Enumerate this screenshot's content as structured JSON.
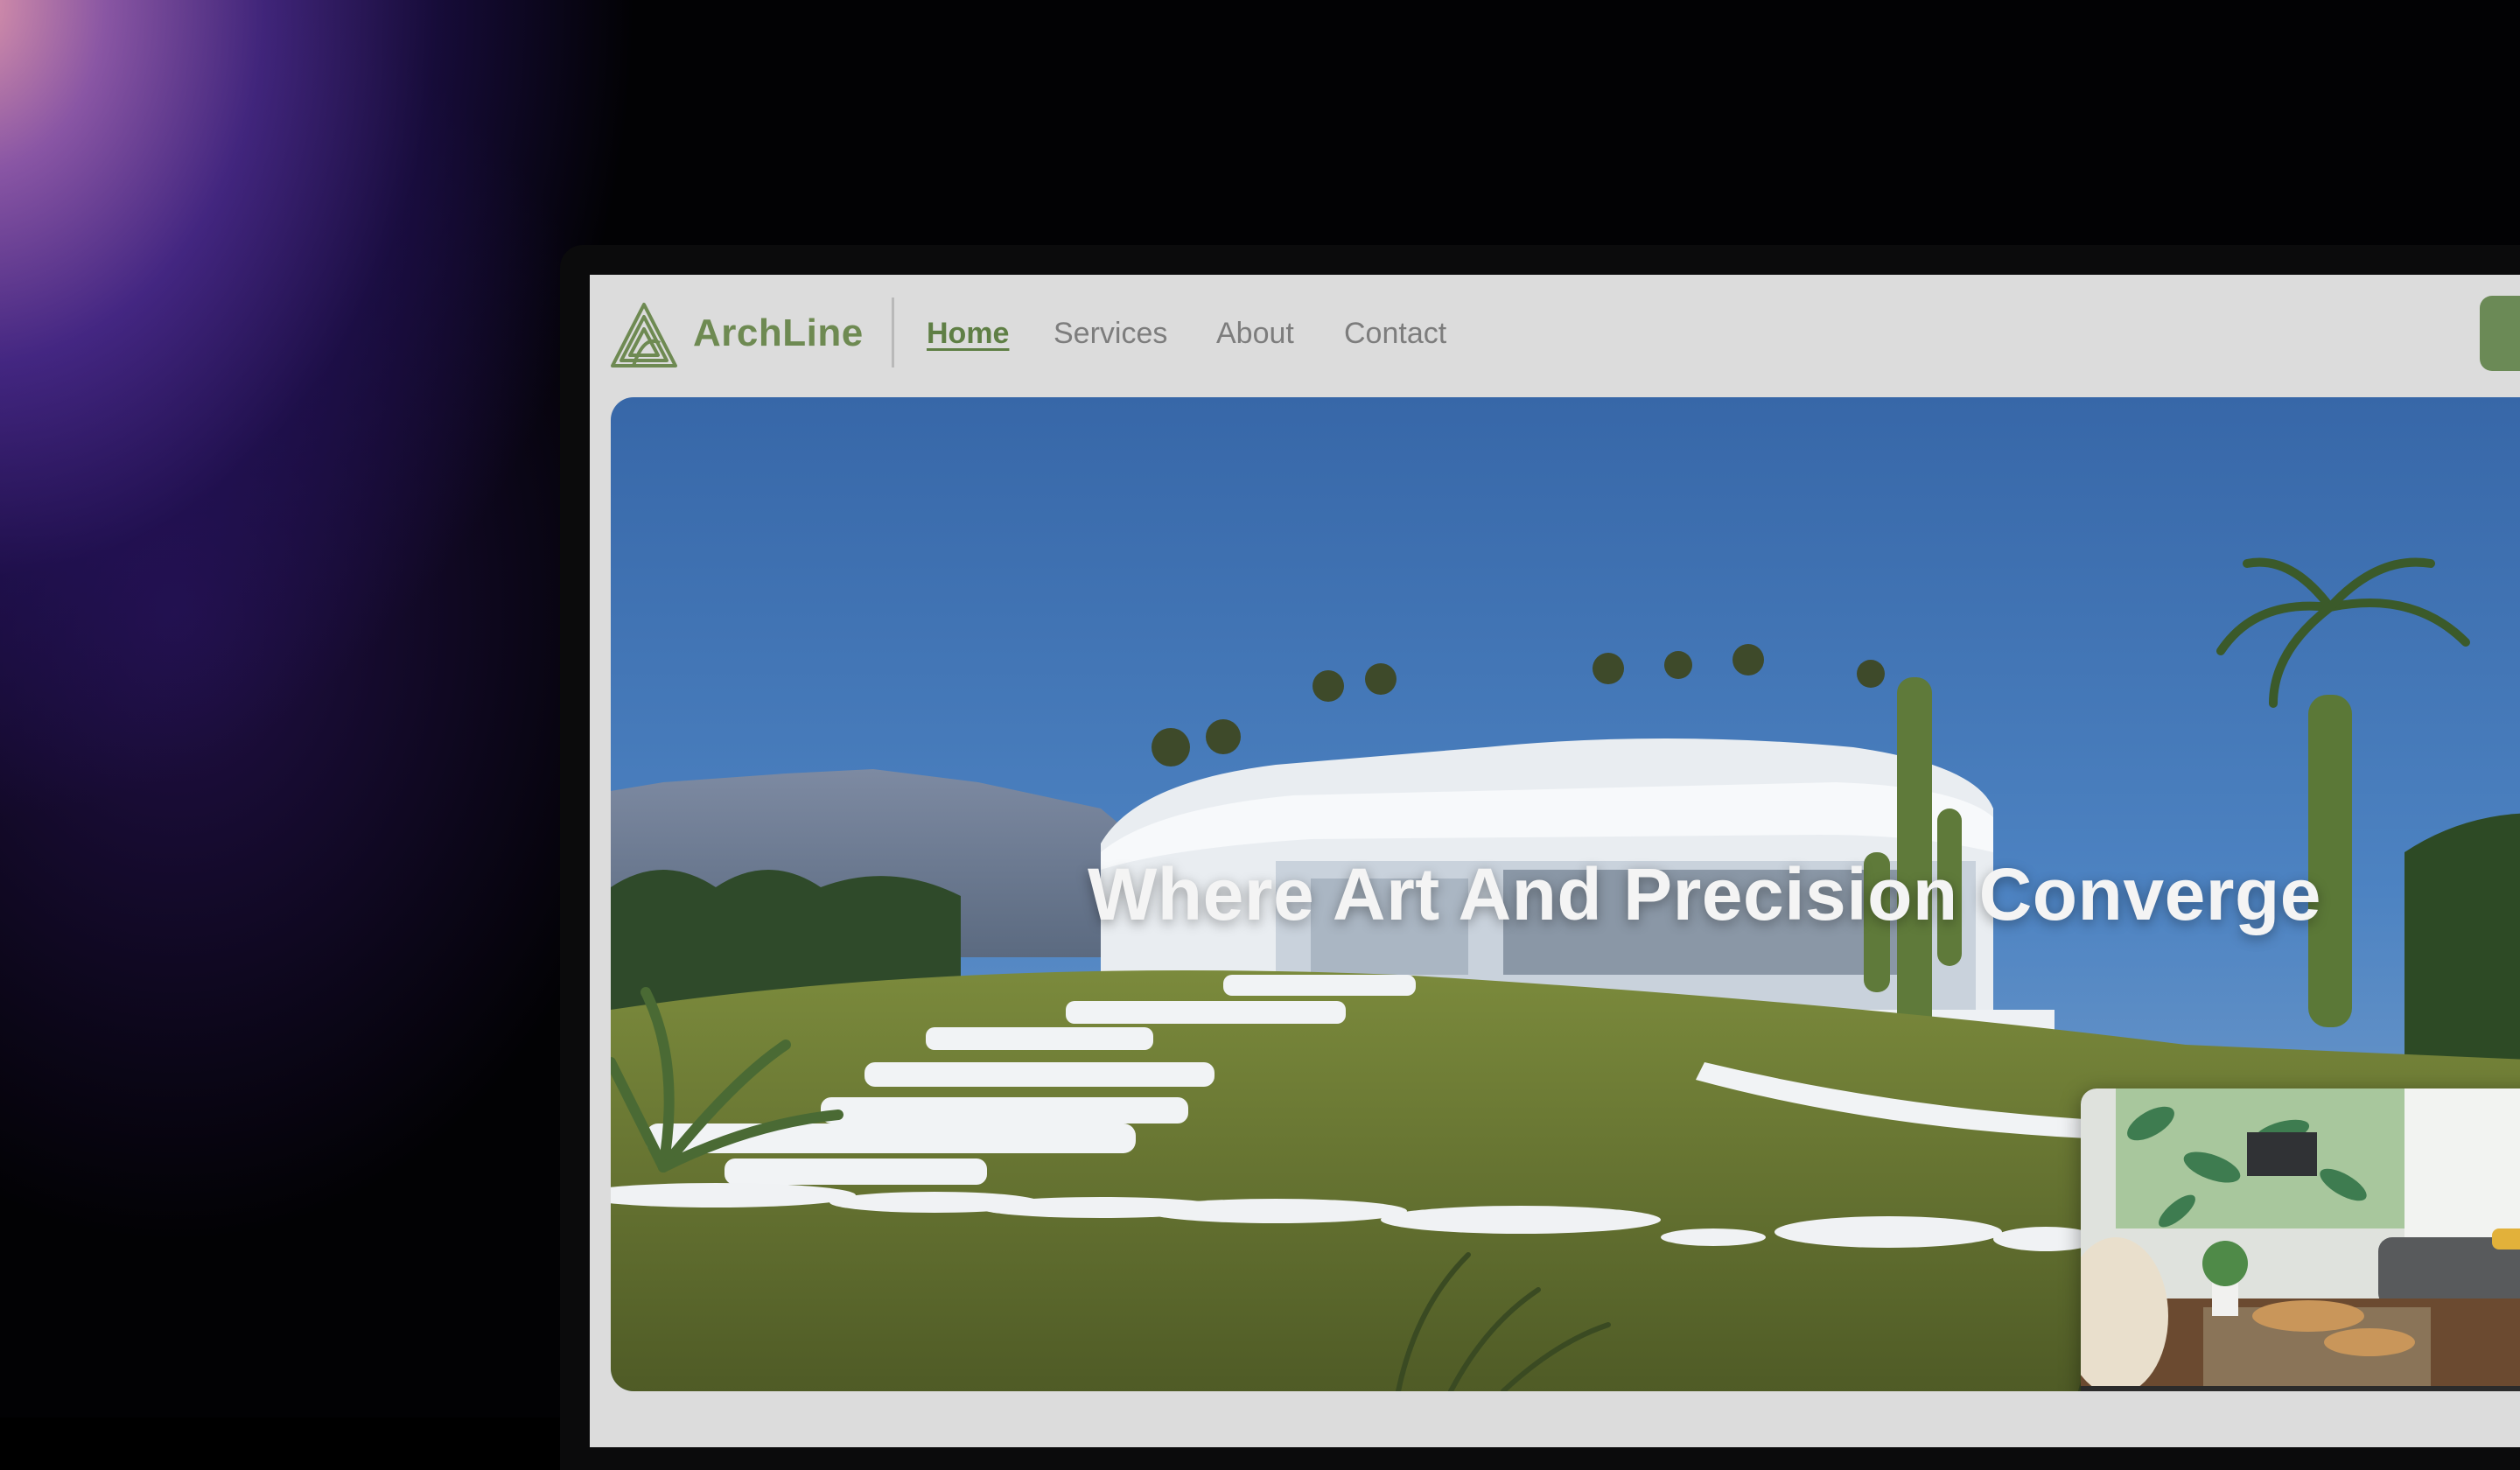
{
  "brand": {
    "name": "ArchLine",
    "color": "#6e8a52"
  },
  "nav": {
    "links": [
      {
        "label": "Home",
        "active": true
      },
      {
        "label": "Services",
        "active": false
      },
      {
        "label": "About",
        "active": false
      },
      {
        "label": "Contact",
        "active": false
      }
    ],
    "cta_color": "#6b8a56"
  },
  "hero": {
    "headline": "Where Art And Precision Converge",
    "image": "modern-white-villa-on-hillside"
  },
  "thumbnail": {
    "image": "living-room-interior",
    "progress_segments": 4,
    "active_segment": 1
  }
}
